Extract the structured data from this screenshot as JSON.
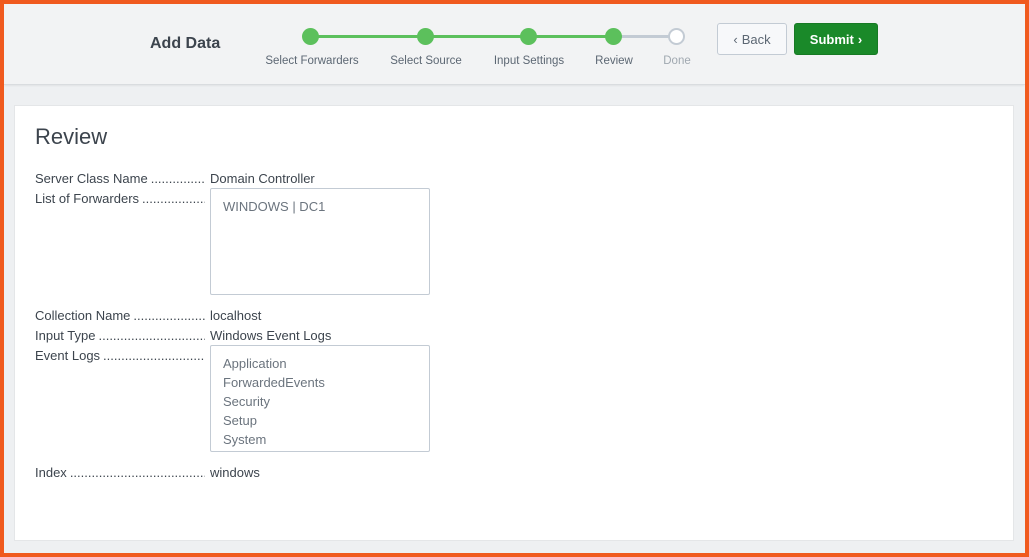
{
  "header": {
    "title": "Add Data",
    "steps": [
      {
        "label": "Select Forwarders",
        "state": "complete"
      },
      {
        "label": "Select Source",
        "state": "complete"
      },
      {
        "label": "Input Settings",
        "state": "complete"
      },
      {
        "label": "Review",
        "state": "current"
      },
      {
        "label": "Done",
        "state": "pending"
      }
    ],
    "back_label": "Back",
    "submit_label": "Submit"
  },
  "review": {
    "title": "Review",
    "server_class": {
      "label": "Server Class Name",
      "value": "Domain Controller"
    },
    "forwarders": {
      "label": "List of Forwarders",
      "items": [
        "WINDOWS | DC1"
      ]
    },
    "collection": {
      "label": "Collection Name",
      "value": "localhost"
    },
    "input_type": {
      "label": "Input Type",
      "value": "Windows Event Logs"
    },
    "event_logs": {
      "label": "Event Logs",
      "items": [
        "Application",
        "ForwardedEvents",
        "Security",
        "Setup",
        "System"
      ]
    },
    "index": {
      "label": "Index",
      "value": "windows"
    }
  },
  "colors": {
    "step_complete": "#5cc05c",
    "step_pending": "#c3cbd4",
    "submit_bg": "#1a8929",
    "border_accent": "#f05a1e"
  }
}
